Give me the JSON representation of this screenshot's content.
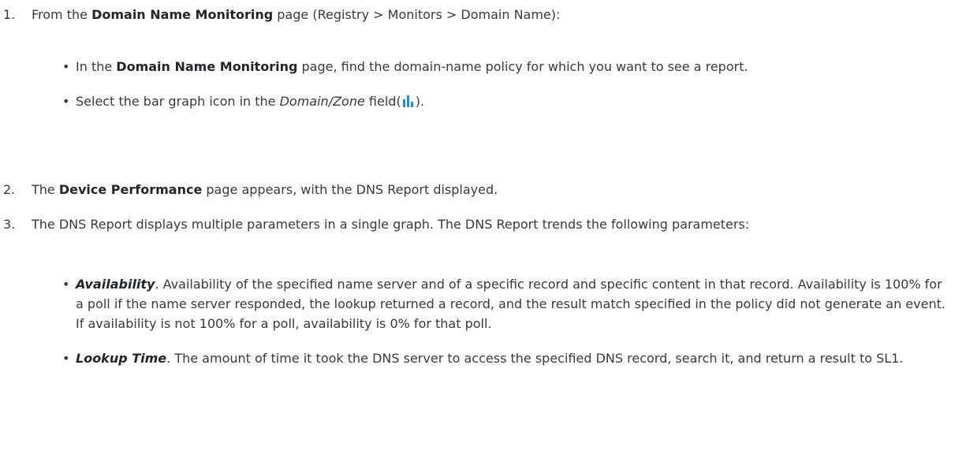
{
  "steps": [
    {
      "number": "1.",
      "before": "From the ",
      "bold": "Domain Name Monitoring",
      "after": " page (Registry > Monitors > Domain Name):"
    },
    {
      "number": "2.",
      "before": "The ",
      "bold": "Device Performance",
      "after": " page appears, with the DNS Report displayed."
    },
    {
      "number": "3.",
      "text": "The DNS Report displays multiple parameters in a single graph. The DNS Report trends the following parameters:"
    }
  ],
  "step1_bullets": {
    "b1": {
      "before": "In the ",
      "bold": "Domain Name Monitoring",
      "after": " page, find the domain-name policy for which you want to see a report."
    },
    "b2": {
      "before": "Select the bar graph icon in the ",
      "italic": "Domain/Zone",
      "middle": " field(",
      "icon": "bar-graph-icon",
      "after": ")."
    }
  },
  "step3_bullets": {
    "availability": {
      "term": "Availability",
      "text": ". Availability of the specified name server and of a specific record and specific content in that record. Availability is 100% for a poll if the name server responded, the lookup returned a record, and the result match specified in the policy did not generate an event. If availability is not 100% for a poll, availability is 0% for that poll."
    },
    "lookup_time": {
      "term": "Lookup Time",
      "text": ". The amount of time it took the DNS server to access the specified DNS record, search it, and return a result to SL1."
    }
  },
  "bullet_char": "•",
  "colors": {
    "text": "#333a40",
    "icon": "#1e90d6"
  }
}
